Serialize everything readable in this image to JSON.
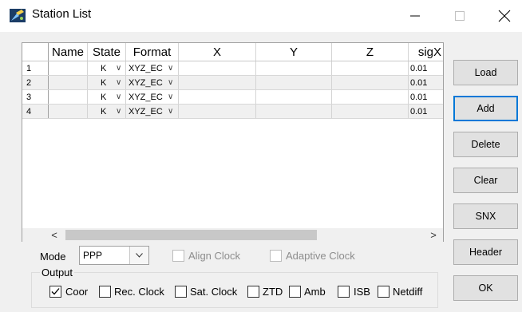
{
  "window": {
    "title": "Station List",
    "icon": "satellite-app-icon",
    "controls": [
      "minimize-icon",
      "maximize-icon",
      "close-icon"
    ]
  },
  "table": {
    "columns": [
      "Name",
      "State",
      "Format",
      "X",
      "Y",
      "Z",
      "sigX"
    ],
    "rows": [
      {
        "num": "1",
        "name": "",
        "state": "K",
        "format": "XYZ_EC",
        "x": "",
        "y": "",
        "z": "",
        "sigx": "0.01"
      },
      {
        "num": "2",
        "name": "",
        "state": "K",
        "format": "XYZ_EC",
        "x": "",
        "y": "",
        "z": "",
        "sigx": "0.01"
      },
      {
        "num": "3",
        "name": "",
        "state": "K",
        "format": "XYZ_EC",
        "x": "",
        "y": "",
        "z": "",
        "sigx": "0.01"
      },
      {
        "num": "4",
        "name": "",
        "state": "K",
        "format": "XYZ_EC",
        "x": "",
        "y": "",
        "z": "",
        "sigx": "0.01"
      }
    ],
    "scroll_left": "<",
    "scroll_right": ">"
  },
  "buttons": {
    "load": "Load",
    "add": "Add",
    "delete": "Delete",
    "clear": "Clear",
    "snx": "SNX",
    "header": "Header",
    "ok": "OK"
  },
  "mode": {
    "label": "Mode",
    "value": "PPP"
  },
  "options": {
    "align_clock": "Align Clock",
    "adaptive_clock": "Adaptive Clock"
  },
  "output": {
    "title": "Output",
    "coor": "Coor",
    "rec_clock": "Rec. Clock",
    "sat_clock": "Sat. Clock",
    "ztd": "ZTD",
    "amb": "Amb",
    "isb": "ISB",
    "netdiff": "Netdiff",
    "coor_checked": true
  },
  "colors": {
    "accent": "#0078d7",
    "window_bg": "#f0f0f0",
    "disabled_text": "#8d8d8d"
  }
}
